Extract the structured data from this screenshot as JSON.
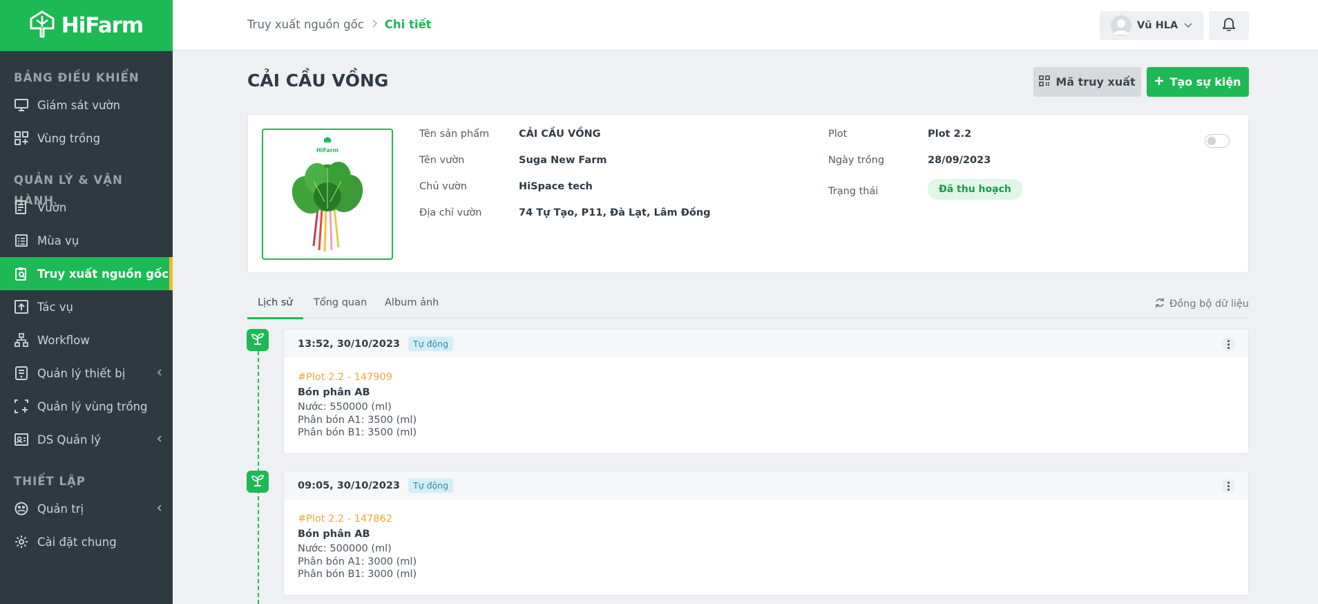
{
  "app": {
    "brand": "HiFarm"
  },
  "sidebar": {
    "sections": [
      {
        "title": "BẢNG ĐIỀU KHIỂN",
        "items": [
          {
            "label": "Giám sát vườn",
            "icon": "monitor-icon"
          },
          {
            "label": "Vùng trồng",
            "icon": "grid-plus-icon"
          }
        ]
      },
      {
        "title": "QUẢN LÝ & VẬN HÀNH",
        "items": [
          {
            "label": "Vườn",
            "icon": "document-icon"
          },
          {
            "label": "Mùa vụ",
            "icon": "list-icon"
          },
          {
            "label": "Truy xuất nguồn gốc",
            "icon": "clipboard-search-icon",
            "active": true
          },
          {
            "label": "Tác vụ",
            "icon": "upload-box-icon"
          },
          {
            "label": "Workflow",
            "icon": "workflow-icon"
          },
          {
            "label": "Quản lý thiết bị",
            "icon": "device-icon",
            "has_children": true
          },
          {
            "label": "Quản lý vùng trồng",
            "icon": "area-select-icon"
          },
          {
            "label": "DS Quản lý",
            "icon": "id-card-icon",
            "has_children": true
          }
        ]
      },
      {
        "title": "THIẾT LẬP",
        "items": [
          {
            "label": "Quản trị",
            "icon": "admin-icon",
            "has_children": true
          },
          {
            "label": "Cài đặt chung",
            "icon": "gear-icon"
          }
        ]
      }
    ]
  },
  "header": {
    "breadcrumb": [
      "Truy xuất nguồn gốc",
      "Chi tiết"
    ],
    "user_name": "Vũ HLA"
  },
  "page": {
    "title": "CẢI CẦU VỒNG",
    "qr_button": "Mã truy xuất",
    "create_button": "Tạo sự kiện"
  },
  "product": {
    "image_brand": "HiFarm",
    "left_fields": [
      {
        "label": "Tên sản phẩm",
        "value": "CẢI CẦU VỒNG"
      },
      {
        "label": "Tên vườn",
        "value": "Suga New Farm"
      },
      {
        "label": "Chủ vườn",
        "value": "HiSpace tech"
      },
      {
        "label": "Địa chỉ vườn",
        "value": "74 Tự Tạo, P11, Đà Lạt, Lâm Đồng"
      }
    ],
    "right_fields": [
      {
        "label": "Plot",
        "value": "Plot 2.2"
      },
      {
        "label": "Ngày trồng",
        "value": "28/09/2023"
      },
      {
        "label": "Trạng thái",
        "value": "Đã thu hoạch"
      }
    ],
    "toggle_on": false
  },
  "tabs": [
    {
      "label": "Lịch sử",
      "active": true
    },
    {
      "label": "Tổng quan",
      "active": false
    },
    {
      "label": "Album ảnh",
      "active": false
    }
  ],
  "sync_label": "Đồng bộ dữ liệu",
  "events": [
    {
      "time": "13:52, 30/10/2023",
      "badge": "Tự động",
      "code": "#Plot 2.2 - 147909",
      "title": "Bón phân AB",
      "lines": [
        "Nước: 550000 (ml)",
        "Phân bón A1: 3500 (ml)",
        "Phân bón B1: 3500 (ml)"
      ]
    },
    {
      "time": "09:05, 30/10/2023",
      "badge": "Tự động",
      "code": "#Plot 2.2 - 147862",
      "title": "Bón phân AB",
      "lines": [
        "Nước: 500000 (ml)",
        "Phân bón A1: 3000 (ml)",
        "Phân bón B1: 3000 (ml)"
      ]
    }
  ],
  "colors": {
    "primary": "#1db954",
    "sidebar": "#2f3a40",
    "accent": "#f5b82e",
    "code": "#f0a830"
  }
}
